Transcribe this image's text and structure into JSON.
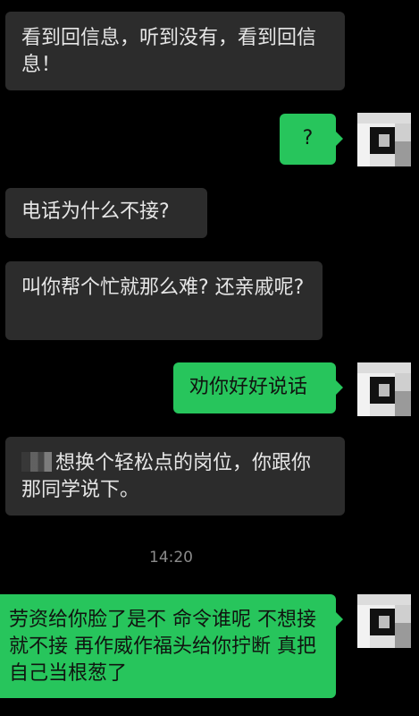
{
  "messages": [
    {
      "side": "left",
      "text": "看到回信息，听到没有，看到回信息！"
    },
    {
      "side": "right",
      "text": "?"
    },
    {
      "side": "left",
      "text": "电话为什么不接?"
    },
    {
      "side": "left",
      "text": "叫你帮个忙就那么难? 还亲戚呢?"
    },
    {
      "side": "right",
      "text": "劝你好好说话"
    },
    {
      "side": "left",
      "text": "想换个轻松点的岗位，你跟你那同学说下。"
    },
    {
      "side": "right",
      "text": "劳资给你脸了是不 命令谁呢 不想接就不接 再作威作福头给你拧断 真把自己当根葱了"
    }
  ],
  "timestamp": "14:20",
  "colors": {
    "background": "#000000",
    "incoming_bubble": "#2c2c2c",
    "outgoing_bubble": "#27c55c",
    "timestamp": "#8a8a8a"
  }
}
